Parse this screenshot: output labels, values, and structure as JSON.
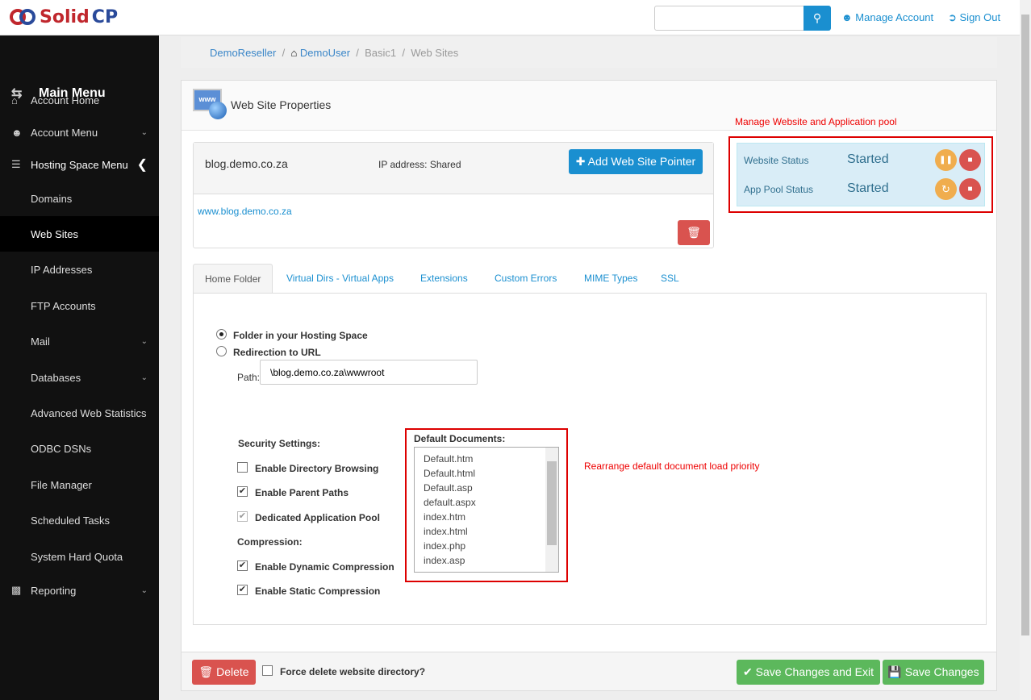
{
  "header": {
    "brand": "SolidCP",
    "search_placeholder": "",
    "manage_account": "Manage Account",
    "sign_out": "Sign Out"
  },
  "sidebar": {
    "title": "Main Menu",
    "items": [
      {
        "label": "Account Home"
      },
      {
        "label": "Account Menu"
      },
      {
        "label": "Hosting Space Menu"
      },
      {
        "label": "Domains"
      },
      {
        "label": "Web Sites"
      },
      {
        "label": "IP Addresses"
      },
      {
        "label": "FTP Accounts"
      },
      {
        "label": "Mail"
      },
      {
        "label": "Databases"
      },
      {
        "label": "Advanced Web Statistics"
      },
      {
        "label": "ODBC DSNs"
      },
      {
        "label": "File Manager"
      },
      {
        "label": "Scheduled Tasks"
      },
      {
        "label": "System Hard Quota"
      },
      {
        "label": "Reporting"
      }
    ]
  },
  "breadcrumb": [
    "DemoReseller",
    "DemoUser",
    "Basic1",
    "Web Sites"
  ],
  "page": {
    "title": "Web Site Properties",
    "site": {
      "name": "blog.demo.co.za",
      "ip": "IP address: Shared",
      "add_pointer": "Add Web Site Pointer",
      "pointer": "www.blog.demo.co.za"
    },
    "note_status": "Manage Website and Application pool",
    "status": {
      "website_label": "Website Status",
      "website_value": "Started",
      "pool_label": "App Pool Status",
      "pool_value": "Started"
    },
    "tabs": [
      "Home Folder",
      "Virtual Dirs - Virtual Apps",
      "Extensions",
      "Custom Errors",
      "MIME Types",
      "SSL"
    ],
    "home": {
      "opt_folder": "Folder in your Hosting Space",
      "opt_redirect": "Redirection to URL",
      "path_label": "Path:",
      "path_value": "\\blog.demo.co.za\\wwwroot",
      "security_title": "Security Settings:",
      "dir_browsing": "Enable Directory Browsing",
      "parent_paths": "Enable Parent Paths",
      "dedicated_pool": "Dedicated Application Pool",
      "compression_title": "Compression:",
      "dynamic": "Enable Dynamic Compression",
      "static": "Enable Static Compression",
      "dir_browsing_checked": false,
      "parent_paths_checked": true,
      "dedicated_pool_checked": true,
      "dynamic_checked": true,
      "static_checked": true
    },
    "default_docs": {
      "title": "Default Documents:",
      "items": [
        "Default.htm",
        "Default.html",
        "Default.asp",
        "default.aspx",
        "index.htm",
        "index.html",
        "index.php",
        "index.asp"
      ]
    },
    "note_docs": "Rearrange default document load priority",
    "footer": {
      "delete": "Delete",
      "force_delete": "Force delete website directory?",
      "save_exit": "Save Changes and Exit",
      "save": "Save Changes"
    }
  },
  "colors": {
    "primary": "#1a8fd0",
    "danger": "#d9534f",
    "success": "#5cb85c",
    "warning": "#f0ad4e",
    "sidebar": "#111111",
    "annotation": "#dd0000"
  }
}
